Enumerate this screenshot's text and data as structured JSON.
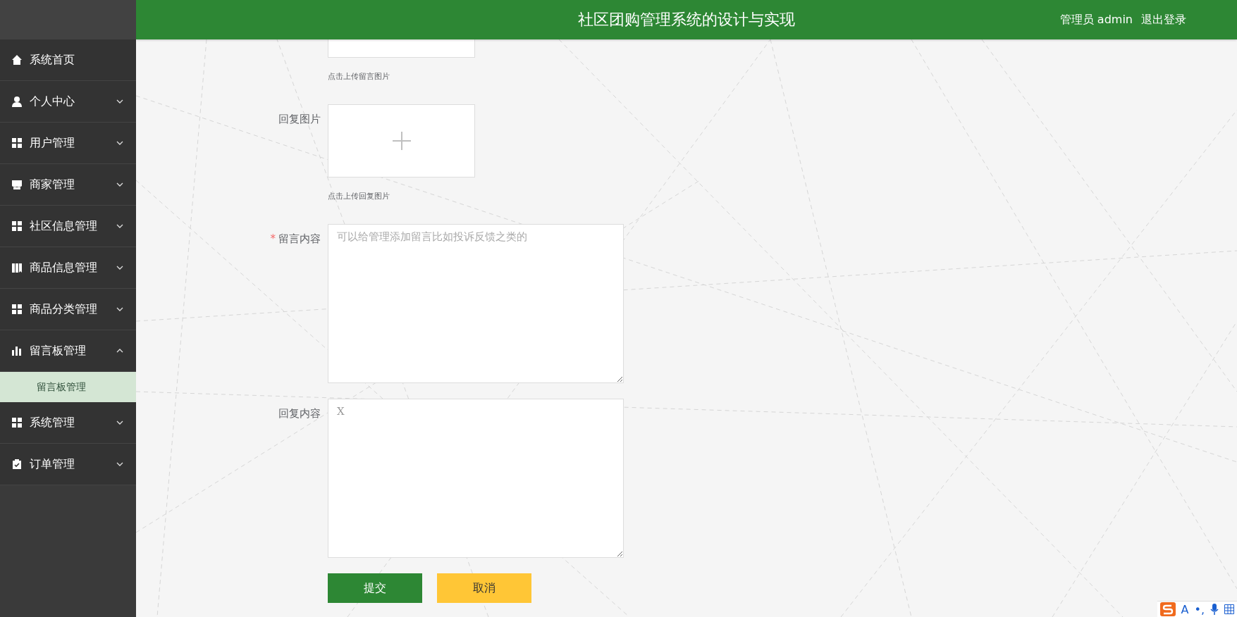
{
  "header": {
    "title": "社区团购管理系统的设计与实现",
    "user": "管理员 admin",
    "logout": "退出登录"
  },
  "sidebar": {
    "items": [
      {
        "label": "系统首页",
        "kind": "home"
      },
      {
        "label": "个人中心",
        "kind": "user",
        "expanded": false
      },
      {
        "label": "用户管理",
        "kind": "grid",
        "expanded": false
      },
      {
        "label": "商家管理",
        "kind": "shop",
        "expanded": false
      },
      {
        "label": "社区信息管理",
        "kind": "grid",
        "expanded": false
      },
      {
        "label": "商品信息管理",
        "kind": "book",
        "expanded": false
      },
      {
        "label": "商品分类管理",
        "kind": "grid",
        "expanded": false
      },
      {
        "label": "留言板管理",
        "kind": "chart",
        "expanded": true,
        "children": [
          {
            "label": "留言板管理",
            "selected": true
          }
        ]
      },
      {
        "label": "系统管理",
        "kind": "grid",
        "expanded": false
      },
      {
        "label": "订单管理",
        "kind": "clipboard",
        "expanded": false
      }
    ]
  },
  "form": {
    "fields": [
      {
        "kind": "upload",
        "cut_off": true,
        "hint": "点击上传留言图片"
      },
      {
        "kind": "upload",
        "label": "回复图片",
        "hint": "点击上传回复图片"
      },
      {
        "kind": "textarea",
        "label": "留言内容",
        "required_mark": "*",
        "placeholder": "可以给管理添加留言比如投诉反馈之类的"
      },
      {
        "kind": "textarea",
        "label": "回复内容",
        "value": "X"
      }
    ],
    "buttons": [
      {
        "label": "提交",
        "kind": "primary"
      },
      {
        "label": "取消",
        "kind": "warning"
      }
    ]
  },
  "ime_toolbar": {
    "mode": "A",
    "punctuation": "•,"
  }
}
